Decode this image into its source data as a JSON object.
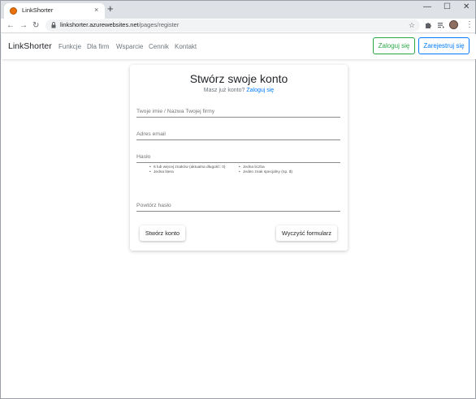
{
  "browser": {
    "tab_title": "LinkShorter",
    "tab_close": "×",
    "new_tab": "+",
    "minimize": "—",
    "maximize": "☐",
    "close": "✕",
    "back": "←",
    "forward": "→",
    "reload": "↻",
    "url_host": "linkshorter.azurewebsites.net",
    "url_path": "/pages/register",
    "bookmark_star": "☆",
    "menu": "⋮"
  },
  "navbar": {
    "brand": "LinkShorter",
    "links": [
      "Funkcje",
      "Dla firm",
      "Wsparcie",
      "Cennik",
      "Kontakt"
    ],
    "login_label": "Zaloguj się",
    "register_label": "Zarejestruj się"
  },
  "form": {
    "title": "Stwórz swoje konto",
    "subtitle_text": "Masz już konto?",
    "subtitle_link": "Zaloguj się",
    "name_label": "Twoje imie / Nazwa Twojej firmy",
    "email_label": "Adres email",
    "password_label": "Hasło",
    "password_rules": [
      "6 lub więcej znaków (aktualna długość: 0)",
      "Jedna litera",
      "Jedna liczba",
      "Jeden znak specjalny (np. $)"
    ],
    "repeat_label": "Powtórz hasło",
    "create_button": "Stwórz konto",
    "clear_button": "Wyczyść formularz"
  },
  "colors": {
    "success": "#28a745",
    "primary": "#007bff"
  }
}
